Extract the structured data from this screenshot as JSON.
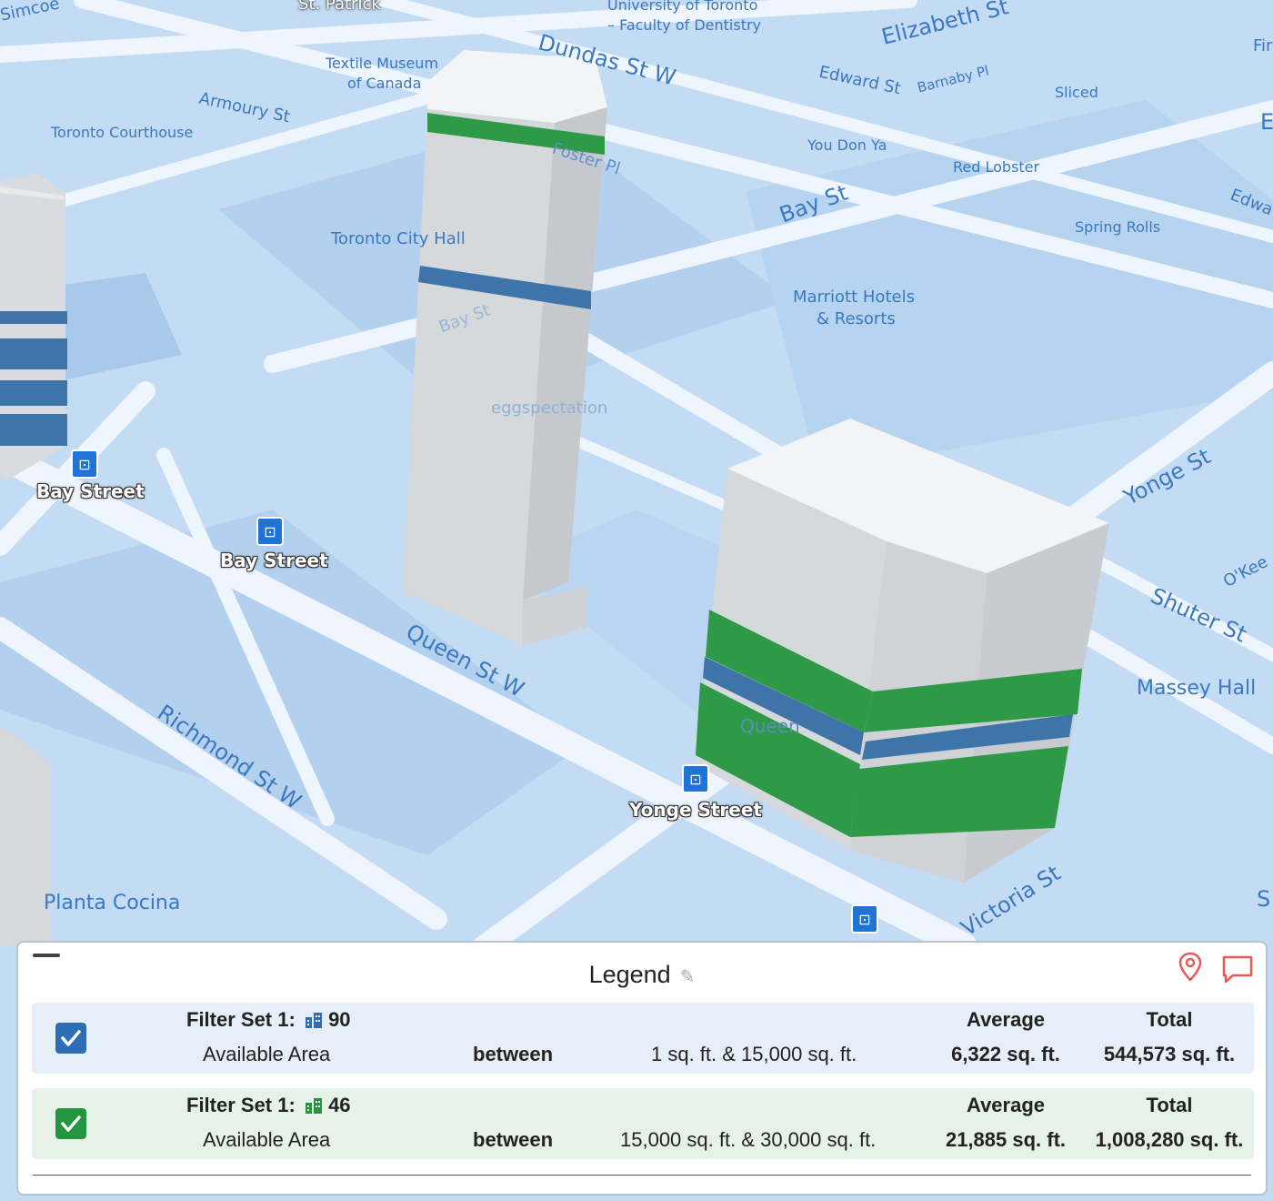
{
  "map": {
    "streets": {
      "dundas": "Dundas St W",
      "armoury": "Armoury St",
      "elizabeth": "Elizabeth St",
      "edward": "Edward St",
      "barnaby": "Barnaby Pl",
      "foster": "Foster Pl",
      "bay": "Bay St",
      "bay_faint": "Bay St",
      "yonge": "Yonge St",
      "shuter": "Shuter St",
      "okeefe": "O'Kee",
      "queen": "Queen St W",
      "richmond": "Richmond St W",
      "victoria": "Victoria St",
      "edward2": "Edwa",
      "fir": "Fir",
      "simcoe": "Simcoe",
      "e_edge": "E",
      "s_edge": "S"
    },
    "pois": {
      "st_patrick": "St. Patrick",
      "uoft_1": "University of Toronto",
      "uoft_2": "– Faculty of Dentistry",
      "textile_1": "Textile Museum",
      "textile_2": "of Canada",
      "courthouse": "Toronto Courthouse",
      "city_hall": "Toronto City Hall",
      "you_don_ya": "You Don Ya",
      "sliced": "Sliced",
      "red_lobster": "Red Lobster",
      "spring_rolls": "Spring Rolls",
      "marriott_1": "Marriott Hotels",
      "marriott_2": "& Resorts",
      "eggspectation": "eggspectation",
      "massey_hall": "Massey Hall",
      "planta": "Planta Cocina",
      "queen_station": "Queen"
    },
    "transit": {
      "bay1": "Bay Street",
      "bay2": "Bay Street",
      "yonge": "Yonge Street"
    },
    "colors": {
      "water_bg": "#c4dbf4",
      "road": "#eaf2fb",
      "building_white": "#d9dcdf",
      "band_blue": "#3e74a8",
      "band_green": "#2e9a48"
    }
  },
  "legend": {
    "title": "Legend",
    "icons": [
      "edit-pencil-icon",
      "location-pin-icon",
      "comment-icon"
    ],
    "filters": [
      {
        "checked": true,
        "color": "#2c6db3",
        "title": "Filter Set 1:",
        "count": "90",
        "field": "Available Area",
        "operator": "between",
        "range": "1 sq. ft.  &  15,000 sq. ft.",
        "average_label": "Average",
        "average": "6,322 sq. ft.",
        "total_label": "Total",
        "total": "544,573 sq. ft."
      },
      {
        "checked": true,
        "color": "#23953f",
        "title": "Filter Set 1:",
        "count": "46",
        "field": "Available Area",
        "operator": "between",
        "range": "15,000 sq. ft.  &  30,000 sq. ft.",
        "average_label": "Average",
        "average": "21,885 sq. ft.",
        "total_label": "Total",
        "total": "1,008,280 sq. ft."
      }
    ]
  }
}
